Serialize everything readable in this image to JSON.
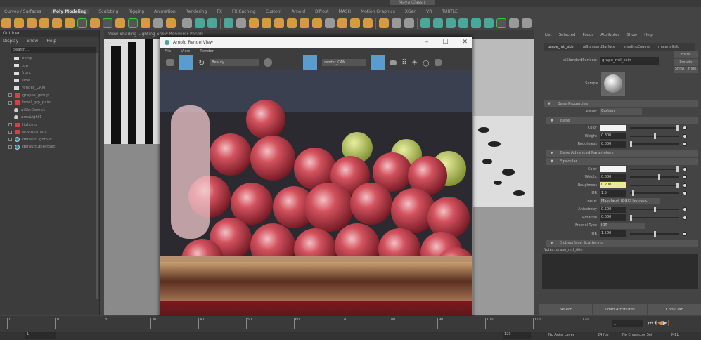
{
  "shelf_tabs": [
    "Curves / Surfaces",
    "Poly Modeling",
    "Sculpting",
    "Rigging",
    "Animation",
    "Rendering",
    "FX",
    "FX Caching",
    "Custom",
    "Arnold",
    "Bifrost",
    "MASH",
    "Motion Graphics",
    "XGen",
    "VR",
    "TURTLE"
  ],
  "active_shelf_tab": "Poly Modeling",
  "workspace": "Maya Classic",
  "outliner": {
    "title": "Outliner",
    "menu": [
      "Display",
      "Show",
      "Help"
    ],
    "search_placeholder": "Search...",
    "items": [
      {
        "label": "persp",
        "icon": "camera-icon"
      },
      {
        "label": "top",
        "icon": "camera-icon"
      },
      {
        "label": "front",
        "icon": "camera-icon"
      },
      {
        "label": "side",
        "icon": "camera-icon"
      },
      {
        "label": "render_CAM",
        "icon": "camera-icon"
      },
      {
        "label": "grapes_group",
        "icon": "group-icon"
      },
      {
        "label": "bowl_grp_paint",
        "icon": "group-icon"
      },
      {
        "label": "aiSkyDome1",
        "icon": "light-icon"
      },
      {
        "label": "areaLight1",
        "icon": "light-icon"
      },
      {
        "label": "lighting",
        "icon": "group-icon"
      },
      {
        "label": "environment",
        "icon": "group-icon"
      },
      {
        "label": "defaultLightSet",
        "icon": "set-icon"
      },
      {
        "label": "defaultObjectSet",
        "icon": "set-icon"
      }
    ]
  },
  "viewport": {
    "menu": "View   Shading   Lighting   Show   Renderer   Panels"
  },
  "render_view": {
    "title": "Arnold RenderView",
    "menu": [
      "File",
      "View",
      "Render"
    ],
    "aov": "Beauty",
    "camera": "render_CAM"
  },
  "attribute_editor": {
    "menu": [
      "List",
      "Selected",
      "Focus",
      "Attributes",
      "Show",
      "Help"
    ],
    "tabs": [
      "grape_mtl_skin",
      "aiStandardSurface",
      "shadingEngine",
      "materialInfo"
    ],
    "name_label": "aiStandardSurface:",
    "name_value": "grape_mtl_skin",
    "side_buttons": [
      "Focus",
      "Presets",
      "Show",
      "Hide"
    ],
    "sample_label": "Sample",
    "sections": {
      "base_properties": "Base Properties",
      "preset_label": "Preset",
      "preset_value": "Custom",
      "base": "Base",
      "advanced": "Base Advanced Parameters",
      "specular": "Specular",
      "subsurface": "Subsurface Scattering"
    },
    "base_rows": [
      {
        "label": "Color",
        "value": "",
        "slider": 0.98,
        "type": "color"
      },
      {
        "label": "Weight",
        "value": "0.800",
        "slider": 0.5
      },
      {
        "label": "Roughness",
        "value": "0.000",
        "slider": 0.0
      }
    ],
    "specular_rows": [
      {
        "label": "Color",
        "value": "",
        "slider": 0.98,
        "type": "color"
      },
      {
        "label": "Weight",
        "value": "0.600",
        "slider": 0.6
      },
      {
        "label": "Roughness",
        "value": "0.200",
        "slider": 0.98,
        "type": "highlight"
      },
      {
        "label": "IOR",
        "value": "1.5",
        "slider": 0.05
      },
      {
        "label": "BRDF",
        "value": "Microfacet (GGX) Isotropic",
        "type": "dropdown"
      },
      {
        "label": "Anisotropy",
        "value": "0.500",
        "slider": 0.5
      },
      {
        "label": "Rotation",
        "value": "0.000",
        "slider": 0.0
      },
      {
        "label": "Fresnel Type",
        "value": "IOR",
        "type": "dropdown"
      },
      {
        "label": "IOR",
        "value": "1.500",
        "slider": 0.5
      }
    ],
    "notes_label": "Notes: grape_mtl_skin",
    "buttons": [
      "Select",
      "Load Attributes",
      "Copy Tab"
    ]
  },
  "timeline": {
    "ticks": [
      "1",
      "10",
      "20",
      "30",
      "40",
      "50",
      "60",
      "70",
      "80",
      "90",
      "100",
      "110",
      "120"
    ],
    "current_frame": "1",
    "start": "1",
    "end": "120"
  },
  "bottombar": {
    "fps": "24 fps",
    "anim_layer": "No Anim Layer",
    "char_set": "No Character Set",
    "lang": "MEL"
  }
}
